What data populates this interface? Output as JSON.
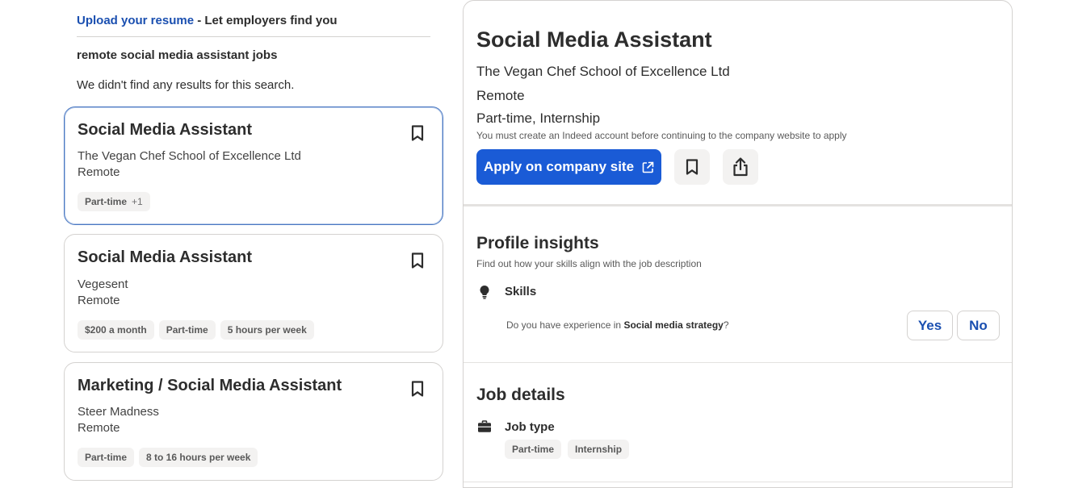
{
  "search": {
    "upload_link": "Upload your resume",
    "upload_rest": " - Let employers find you",
    "title": "remote social media assistant jobs",
    "no_results": "We didn't find any results for this search."
  },
  "jobs": [
    {
      "title": "Social Media Assistant",
      "company": "The Vegan Chef School of Excellence Ltd",
      "location": "Remote",
      "tags": [
        "Part-time"
      ],
      "more": "+1",
      "selected": true
    },
    {
      "title": "Social Media Assistant",
      "company": "Vegesent",
      "location": "Remote",
      "tags": [
        "$200 a month",
        "Part-time",
        "5 hours per week"
      ]
    },
    {
      "title": "Marketing / Social Media Assistant",
      "company": "Steer Madness",
      "location": "Remote",
      "tags": [
        "Part-time",
        "8 to 16 hours per week"
      ]
    }
  ],
  "detail": {
    "title": "Social Media Assistant",
    "company": "The Vegan Chef School of Excellence Ltd",
    "location": "Remote",
    "job_type": "Part-time, Internship",
    "note": "You must create an Indeed account before continuing to the company website to apply",
    "apply_label": "Apply on company site",
    "save_icon": "bookmark-icon",
    "share_icon": "share-icon",
    "accent_color": "#1a5bd6"
  },
  "insights": {
    "heading": "Profile insights",
    "subheading": "Find out how your skills align with the job description",
    "skills_label": "Skills",
    "question_prefix": "Do you have experience in ",
    "question_skill": "Social media strategy",
    "question_suffix": "?",
    "yes_label": "Yes",
    "no_label": "No"
  },
  "job_details": {
    "heading": "Job details",
    "job_type_label": "Job type",
    "tags": [
      "Part-time",
      "Internship"
    ]
  }
}
